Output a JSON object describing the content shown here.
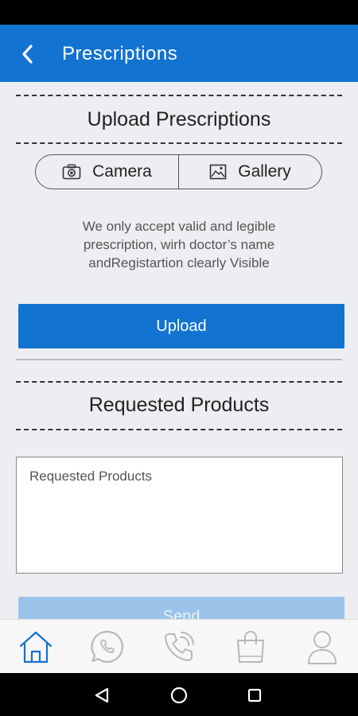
{
  "app_bar": {
    "title": "Prescriptions",
    "back_icon": "chevron-left-icon"
  },
  "upload_section": {
    "heading": "Upload Prescriptions",
    "camera_label": "Camera",
    "gallery_label": "Gallery",
    "info_text": "We only accept valid and legible prescription, wirh doctor’s name andRegistartion clearly Visible",
    "upload_label": "Upload"
  },
  "products_section": {
    "heading": "Requested Products",
    "input_placeholder": "Requested Products",
    "input_value": "",
    "send_label": "Send"
  },
  "bottom_nav": {
    "items": [
      {
        "icon": "home-icon",
        "active": true
      },
      {
        "icon": "whatsapp-icon",
        "active": false
      },
      {
        "icon": "phone-call-icon",
        "active": false
      },
      {
        "icon": "shopping-bag-icon",
        "active": false
      },
      {
        "icon": "profile-icon",
        "active": false
      }
    ]
  },
  "system_nav": {
    "items": [
      "back-triangle-icon",
      "home-circle-icon",
      "recents-square-icon"
    ]
  },
  "colors": {
    "primary": "#1273d1",
    "disabled": "#9cc3ea",
    "background": "#eceef1",
    "nav_active": "#1273d1",
    "nav_inactive": "#b8b8b8"
  }
}
